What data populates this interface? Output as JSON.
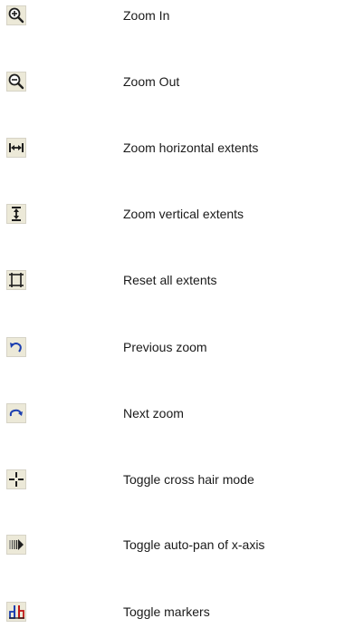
{
  "items": [
    {
      "icon": "zoom-in-icon",
      "label": "Zoom In"
    },
    {
      "icon": "zoom-out-icon",
      "label": "Zoom Out"
    },
    {
      "icon": "zoom-horizontal-extents-icon",
      "label": "Zoom horizontal extents"
    },
    {
      "icon": "zoom-vertical-extents-icon",
      "label": "Zoom vertical extents"
    },
    {
      "icon": "reset-extents-icon",
      "label": "Reset all extents"
    },
    {
      "icon": "previous-zoom-icon",
      "label": "Previous zoom"
    },
    {
      "icon": "next-zoom-icon",
      "label": "Next zoom"
    },
    {
      "icon": "cross-hair-icon",
      "label": "Toggle cross hair mode"
    },
    {
      "icon": "auto-pan-icon",
      "label": "Toggle auto-pan of x-axis"
    },
    {
      "icon": "markers-icon",
      "label": "Toggle markers"
    }
  ]
}
